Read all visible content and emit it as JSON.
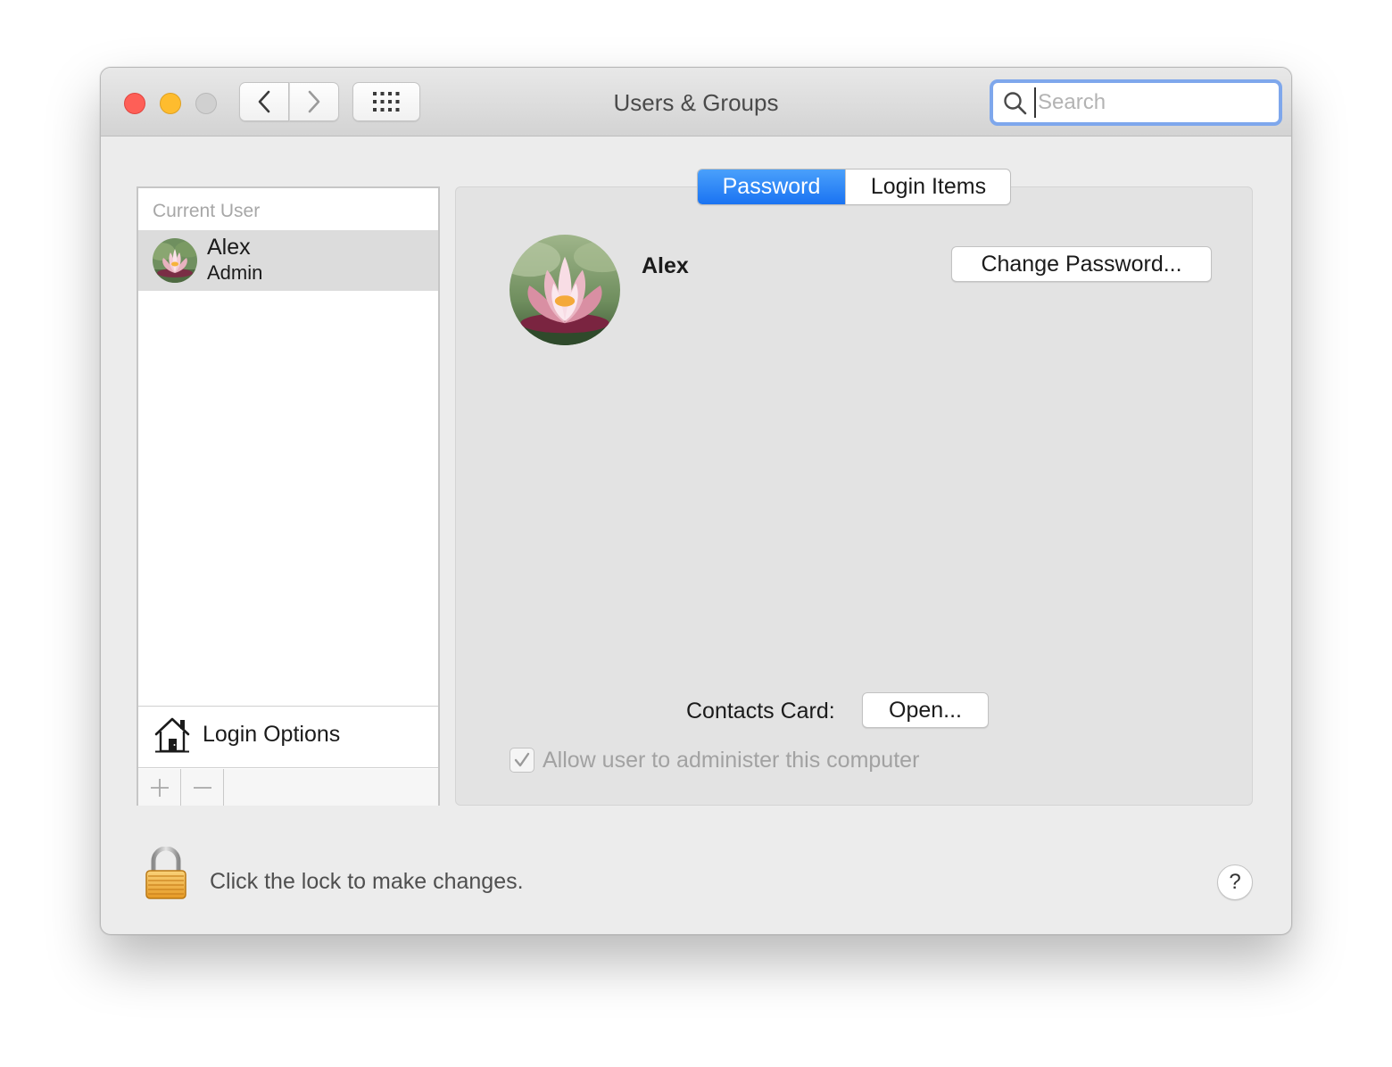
{
  "window": {
    "title": "Users & Groups"
  },
  "search": {
    "placeholder": "Search",
    "value": ""
  },
  "sidebar": {
    "section_header": "Current User",
    "users": [
      {
        "name": "Alex",
        "role": "Admin",
        "selected": true,
        "avatar": "water-lily-photo"
      }
    ],
    "login_options_label": "Login Options",
    "add_symbol": "+",
    "remove_symbol": "—"
  },
  "tabs": [
    {
      "label": "Password",
      "active": true
    },
    {
      "label": "Login Items",
      "active": false
    }
  ],
  "detail": {
    "user_name": "Alex",
    "change_password_label": "Change Password...",
    "contacts_label": "Contacts Card:",
    "open_label": "Open...",
    "admin_checkbox_label": "Allow user to administer this computer",
    "admin_checked": true,
    "admin_enabled": false
  },
  "footer": {
    "lock_text": "Click the lock to make changes.",
    "help_label": "?"
  },
  "colors": {
    "accent": "#1a73f2",
    "close": "#fe5f57",
    "minimize": "#febc2e",
    "zoom_disabled": "#d0d0d0",
    "search_focus": "#7ea7ec"
  }
}
